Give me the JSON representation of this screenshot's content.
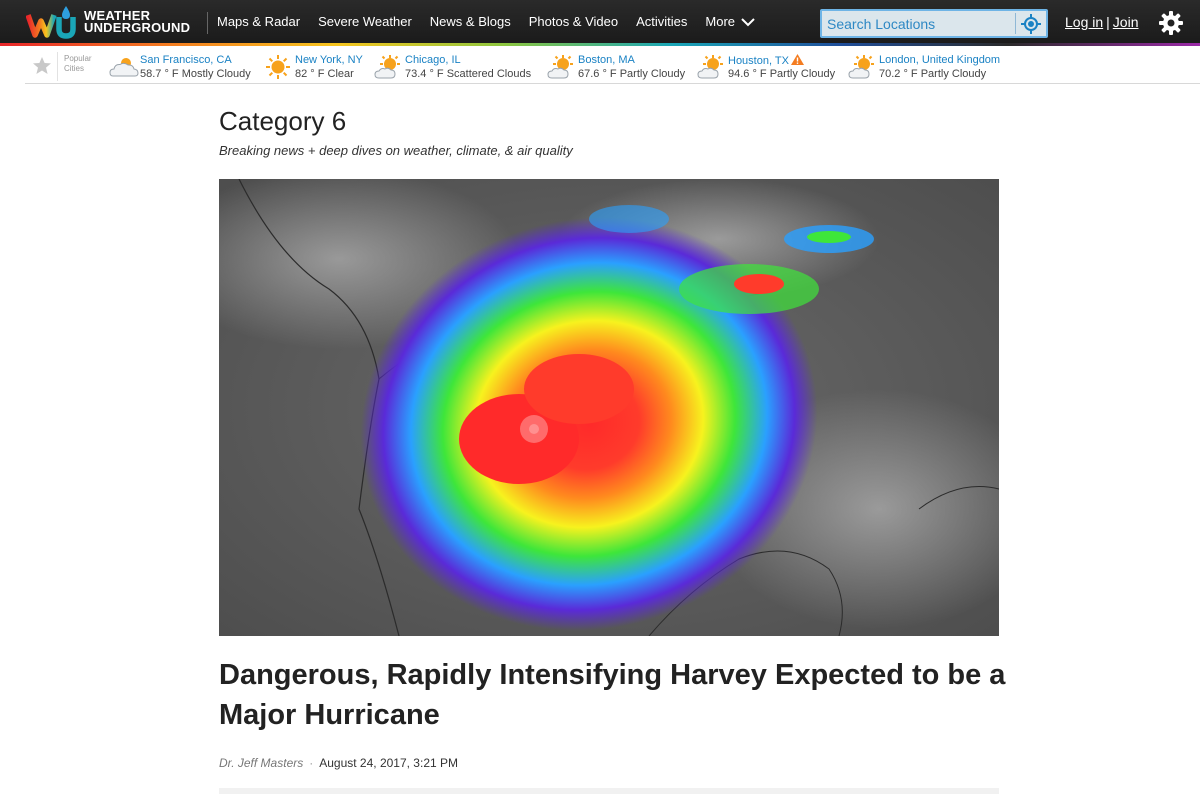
{
  "header": {
    "logo_line1": "WEATHER",
    "logo_line2": "UNDERGROUND",
    "nav": [
      "Maps & Radar",
      "Severe Weather",
      "News & Blogs",
      "Photos & Video",
      "Activities",
      "More"
    ],
    "search_placeholder": "Search Locations",
    "login_label": "Log in",
    "separator": "|",
    "join_label": "Join"
  },
  "popular": {
    "label_line1": "Popular",
    "label_line2": "Cities",
    "cities": [
      {
        "name": "San Francisco, CA",
        "weather": "58.7 ° F Mostly Cloudy",
        "icon": "mostly-cloudy-icon",
        "warning": false
      },
      {
        "name": "New York, NY",
        "weather": "82 ° F Clear",
        "icon": "sunny-icon",
        "warning": false
      },
      {
        "name": "Chicago, IL",
        "weather": "73.4 ° F Scattered Clouds",
        "icon": "partly-cloudy-icon",
        "warning": false
      },
      {
        "name": "Boston, MA",
        "weather": "67.6 ° F Partly Cloudy",
        "icon": "partly-cloudy-icon",
        "warning": false
      },
      {
        "name": "Houston, TX",
        "weather": "94.6 ° F Partly Cloudy",
        "icon": "partly-cloudy-icon",
        "warning": true
      },
      {
        "name": "London, United Kingdom",
        "weather": "70.2 ° F Partly Cloudy",
        "icon": "partly-cloudy-icon",
        "warning": false
      }
    ]
  },
  "article": {
    "section_title": "Category 6",
    "section_subtitle": "Breaking news + deep dives on weather, climate, & air quality",
    "headline": "Dangerous, Rapidly Intensifying Harvey Expected to be a Major Hurricane",
    "author": "Dr. Jeff Masters",
    "byline_separator": "·",
    "date": "August 24, 2017, 3:21 PM"
  },
  "colors": {
    "nav_bg": "#1f1f1f",
    "link_blue": "#1a82c4",
    "search_border": "#6eb4e6"
  }
}
